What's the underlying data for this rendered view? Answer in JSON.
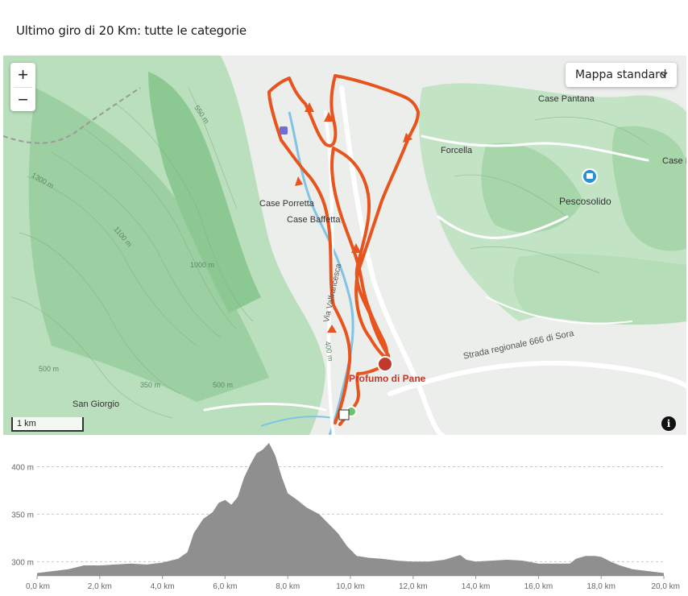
{
  "title": "Ultimo giro di 20 Km: tutte le categorie",
  "map": {
    "zoom_in": "+",
    "zoom_out": "−",
    "style_select": "Mappa standard",
    "scale_label": "1 km",
    "info": "i",
    "poi": "Profumo di Pane",
    "road_label": "Strada regionale 666 di Sora",
    "via_label": "Via Valfrancesca",
    "places": {
      "case_pantana": "Case Pantana",
      "forcella": "Forcella",
      "case_f": "Case F",
      "pescosolido": "Pescosolido",
      "case_porretta": "Case Porretta",
      "case_baffetta": "Case Baffetta",
      "san_giorgio": "San Giorgio"
    },
    "contours": [
      "550 m",
      "1300 m",
      "1100 m",
      "1000 m",
      "500 m",
      "350 m",
      "500 m",
      "400 m"
    ],
    "colors": {
      "route": "#e8541e",
      "forest": "#a5d6a7",
      "water": "#7fc4e6",
      "road": "#ffffff"
    }
  },
  "chart_data": {
    "type": "area",
    "ylabel_ticks": [
      "400 m",
      "350 m",
      "300 m"
    ],
    "y_ticks": [
      400,
      350,
      300
    ],
    "x_ticks": [
      "0,0 km",
      "2,0 km",
      "4,0 km",
      "6,0 km",
      "8,0 km",
      "10,0 km",
      "12,0 km",
      "14,0 km",
      "16,0 km",
      "18,0 km",
      "20,0 km"
    ],
    "x_values": [
      0,
      2,
      4,
      6,
      8,
      10,
      12,
      14,
      16,
      18,
      20
    ],
    "xlim": [
      0,
      20
    ],
    "ylim": [
      285,
      425
    ],
    "grid": true,
    "fill_color": "#8f8f8f",
    "profile_km": [
      0,
      0.5,
      1,
      1.5,
      2,
      2.5,
      3,
      3.5,
      4,
      4.5,
      4.8,
      5,
      5.3,
      5.6,
      5.8,
      6,
      6.2,
      6.4,
      6.6,
      6.8,
      7,
      7.2,
      7.4,
      7.6,
      7.8,
      8,
      8.3,
      8.6,
      9,
      9.3,
      9.6,
      9.9,
      10.2,
      10.6,
      11,
      11.5,
      12,
      12.5,
      13,
      13.3,
      13.5,
      13.7,
      14,
      14.5,
      15,
      15.5,
      16,
      16.5,
      17,
      17.2,
      17.5,
      17.8,
      18,
      18.3,
      18.6,
      19,
      19.5,
      20
    ],
    "profile_m": [
      288,
      290,
      292,
      296,
      296,
      297,
      298,
      297,
      299,
      303,
      310,
      330,
      345,
      352,
      362,
      365,
      360,
      368,
      388,
      402,
      414,
      418,
      425,
      412,
      390,
      372,
      365,
      357,
      350,
      340,
      330,
      316,
      306,
      304,
      303,
      301,
      300,
      300,
      302,
      305,
      307,
      302,
      300,
      301,
      302,
      301,
      298,
      298,
      298,
      303,
      306,
      306,
      305,
      300,
      296,
      292,
      290,
      288
    ]
  }
}
